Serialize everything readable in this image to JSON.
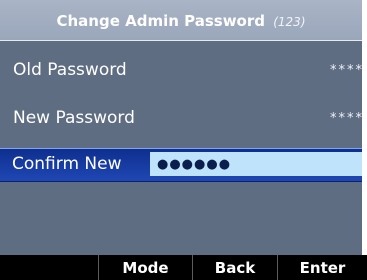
{
  "title": {
    "text": "Change Admin Password",
    "hint": "(123)"
  },
  "fields": [
    {
      "label": "Old Password",
      "value": "****"
    },
    {
      "label": "New Password",
      "value": "****"
    },
    {
      "label": "Confirm New",
      "value": "●●●●●●"
    }
  ],
  "softkeys": {
    "mode": "Mode",
    "back": "Back",
    "enter": "Enter"
  },
  "colors": {
    "background": "#5f6d83",
    "title_bar": "#a0abbf",
    "selected_row": "#1a3da3",
    "input_field": "#bfe3fb",
    "softkey_bar": "#000000"
  }
}
